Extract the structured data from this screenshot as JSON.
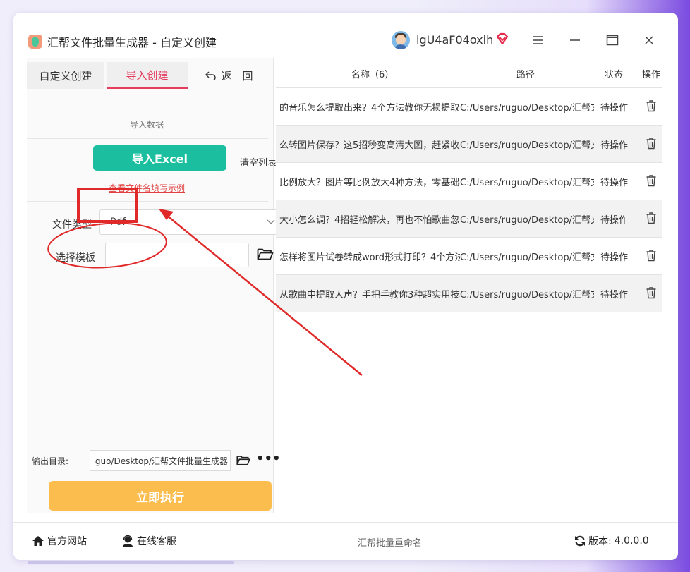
{
  "app": {
    "title": "汇帮文件批量生成器 - 自定义创建",
    "user_name": "igU4aF04oxih",
    "window_controls": [
      "menu-icon",
      "minimize-icon",
      "maximize-icon",
      "close-icon"
    ]
  },
  "tabs": {
    "custom": "自定义创建",
    "import": "导入创建",
    "back": "返　回"
  },
  "import_section": {
    "label": "导入数据",
    "import_button": "导入Excel",
    "clear_button": "清空列表",
    "example_link": "查看文件名填写示例"
  },
  "form": {
    "file_type_label": "文件类型",
    "file_type_value": "Pdf",
    "template_label": "选择模板",
    "template_value": ""
  },
  "output": {
    "label": "输出目录:",
    "path": "guo/Desktop/汇帮文件批量生成器",
    "run_button": "立即执行"
  },
  "table": {
    "headers": {
      "name": "名称（6）",
      "path": "路径",
      "status": "状态",
      "action": "操作"
    },
    "rows": [
      {
        "name": "的音乐怎么提取出来？4个方法教你无损提取，",
        "path": "C:/Users/ruguo/Desktop/汇帮文",
        "status": "待操作"
      },
      {
        "name": "么转图片保存？这5招秒变高清大图，赶紧收藏",
        "path": "C:/Users/ruguo/Desktop/汇帮文",
        "status": "待操作"
      },
      {
        "name": "比例放大？图片等比例放大4种方法，零基础秒",
        "path": "C:/Users/ruguo/Desktop/汇帮文",
        "status": "待操作"
      },
      {
        "name": "大小怎么调？4招轻松解决，再也不怕歌曲忽大",
        "path": "C:/Users/ruguo/Desktop/汇帮文",
        "status": "待操作"
      },
      {
        "name": "怎样将图片试卷转成word形式打印？4个方法",
        "path": "C:/Users/ruguo/Desktop/汇帮文",
        "status": "待操作"
      },
      {
        "name": "从歌曲中提取人声？手把手教你3种超实用技巧",
        "path": "C:/Users/ruguo/Desktop/汇帮文",
        "status": "待操作"
      }
    ]
  },
  "statusbar": {
    "website": "官方网站",
    "support": "在线客服",
    "product": "汇帮批量重命名",
    "version_label": "版本:",
    "version": "4.0.0.0"
  },
  "colors": {
    "accent_pink": "#e53b5e",
    "teal_button": "#1bbf9f",
    "run_button": "#fbbd4e",
    "annotation_red": "#e02a2a"
  }
}
